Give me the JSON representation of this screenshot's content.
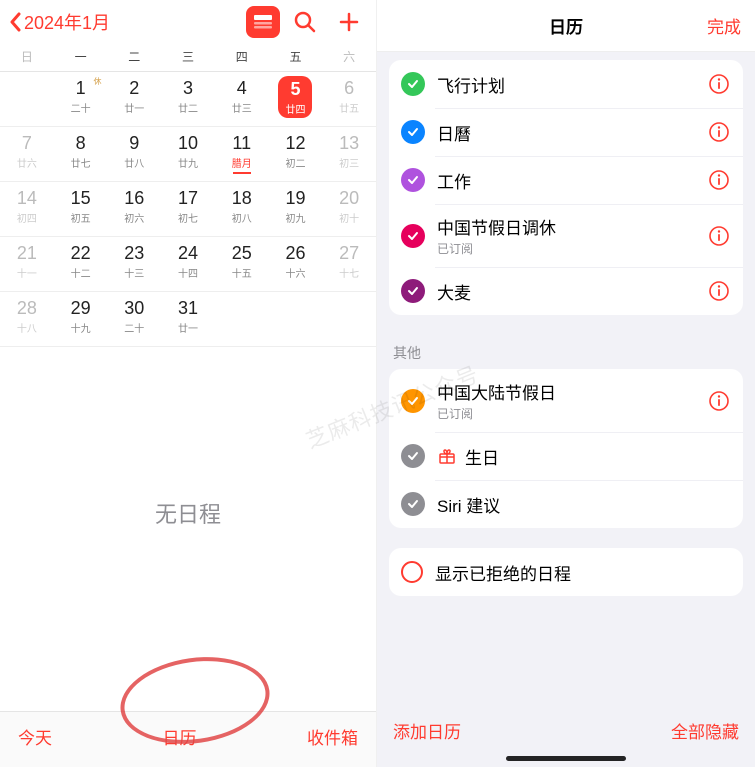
{
  "left": {
    "back_label": "2024年1月",
    "weekdays": [
      "日",
      "一",
      "二",
      "三",
      "四",
      "五",
      "六"
    ],
    "grid": [
      [
        {
          "empty": true
        },
        {
          "num": "1",
          "sub": "二十",
          "badge": "休"
        },
        {
          "num": "2",
          "sub": "廿一"
        },
        {
          "num": "3",
          "sub": "廿二"
        },
        {
          "num": "4",
          "sub": "廿三"
        },
        {
          "num": "5",
          "sub": "廿四",
          "today": true
        },
        {
          "num": "6",
          "sub": "廿五"
        }
      ],
      [
        {
          "num": "7",
          "sub": "廿六"
        },
        {
          "num": "8",
          "sub": "廿七"
        },
        {
          "num": "9",
          "sub": "廿八"
        },
        {
          "num": "10",
          "sub": "廿九"
        },
        {
          "num": "11",
          "sub": "腊月",
          "lunar_month": true
        },
        {
          "num": "12",
          "sub": "初二"
        },
        {
          "num": "13",
          "sub": "初三"
        }
      ],
      [
        {
          "num": "14",
          "sub": "初四"
        },
        {
          "num": "15",
          "sub": "初五"
        },
        {
          "num": "16",
          "sub": "初六"
        },
        {
          "num": "17",
          "sub": "初七"
        },
        {
          "num": "18",
          "sub": "初八"
        },
        {
          "num": "19",
          "sub": "初九"
        },
        {
          "num": "20",
          "sub": "初十"
        }
      ],
      [
        {
          "num": "21",
          "sub": "十一"
        },
        {
          "num": "22",
          "sub": "十二"
        },
        {
          "num": "23",
          "sub": "十三"
        },
        {
          "num": "24",
          "sub": "十四"
        },
        {
          "num": "25",
          "sub": "十五"
        },
        {
          "num": "26",
          "sub": "十六"
        },
        {
          "num": "27",
          "sub": "十七"
        }
      ],
      [
        {
          "num": "28",
          "sub": "十八"
        },
        {
          "num": "29",
          "sub": "十九"
        },
        {
          "num": "30",
          "sub": "二十"
        },
        {
          "num": "31",
          "sub": "廿一"
        },
        {
          "empty": true
        },
        {
          "empty": true
        },
        {
          "empty": true
        }
      ]
    ],
    "no_events": "无日程",
    "toolbar": {
      "today": "今天",
      "calendars": "日历",
      "inbox": "收件箱"
    }
  },
  "right": {
    "title": "日历",
    "done": "完成",
    "section_other": "其他",
    "groups": [
      {
        "items": [
          {
            "title": "飞行计划",
            "color": "#34c759",
            "info": true
          },
          {
            "title": "日曆",
            "color": "#0a84ff",
            "info": true
          },
          {
            "title": "工作",
            "color": "#af52de",
            "info": true
          },
          {
            "title": "中国节假日调休",
            "sub": "已订阅",
            "color": "#e6005c",
            "info": true
          },
          {
            "title": "大麦",
            "color": "#8e1b7a",
            "info": true
          }
        ]
      },
      {
        "label_key": "section_other",
        "items": [
          {
            "title": "中国大陆节假日",
            "sub": "已订阅",
            "color": "#ff9500",
            "info": true
          },
          {
            "title": "生日",
            "color": "#8e8e93",
            "gift": true
          },
          {
            "title": "Siri 建议",
            "color": "#8e8e93"
          }
        ]
      }
    ],
    "rejected": "显示已拒绝的日程",
    "toolbar": {
      "add": "添加日历",
      "hide_all": "全部隐藏"
    }
  },
  "watermark": "芝麻科技讯公众号"
}
